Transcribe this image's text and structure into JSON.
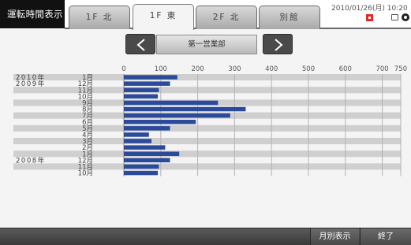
{
  "header": {
    "app_title": "運転時間表示",
    "tabs": [
      {
        "label": "1F 北",
        "active": false
      },
      {
        "label": "1F 東",
        "active": true
      },
      {
        "label": "2F 北",
        "active": false
      },
      {
        "label": "別館",
        "active": false
      }
    ],
    "datetime": "2010/01/26(月) 10:20",
    "icons": [
      "flag-icon",
      "pc-icon",
      "power-icon"
    ]
  },
  "nav": {
    "prev_icon": "chevron-left-icon",
    "next_icon": "chevron-right-icon",
    "department": "第一営業部"
  },
  "chart_data": {
    "type": "bar",
    "orientation": "horizontal",
    "x_ticks": [
      "0",
      "100",
      "200",
      "300",
      "400",
      "500",
      "600",
      "700",
      "750"
    ],
    "xlim": [
      0,
      750
    ],
    "grid": true,
    "bar_color": "#2b4a9a",
    "rows": [
      {
        "year": "2010年",
        "month": "1月",
        "value": 145
      },
      {
        "year": "2009年",
        "month": "12月",
        "value": 125
      },
      {
        "year": "",
        "month": "11月",
        "value": 95
      },
      {
        "year": "",
        "month": "10月",
        "value": 92
      },
      {
        "year": "",
        "month": "9月",
        "value": 255
      },
      {
        "year": "",
        "month": "8月",
        "value": 330
      },
      {
        "year": "",
        "month": "7月",
        "value": 288
      },
      {
        "year": "",
        "month": "6月",
        "value": 195
      },
      {
        "year": "",
        "month": "5月",
        "value": 125
      },
      {
        "year": "",
        "month": "4月",
        "value": 68
      },
      {
        "year": "",
        "month": "3月",
        "value": 75
      },
      {
        "year": "",
        "month": "2月",
        "value": 112
      },
      {
        "year": "",
        "month": "1月",
        "value": 150
      },
      {
        "year": "2008年",
        "month": "12月",
        "value": 125
      },
      {
        "year": "",
        "month": "11月",
        "value": 95
      },
      {
        "year": "",
        "month": "10月",
        "value": 92
      }
    ]
  },
  "footer": {
    "monthly_label": "月別表示",
    "end_label": "終了"
  },
  "colors": {
    "header_bg": "#111111",
    "bar": "#2b4a9a",
    "row_stripe": "#cfcfcf",
    "footer_bg": "#4a4a4a"
  }
}
